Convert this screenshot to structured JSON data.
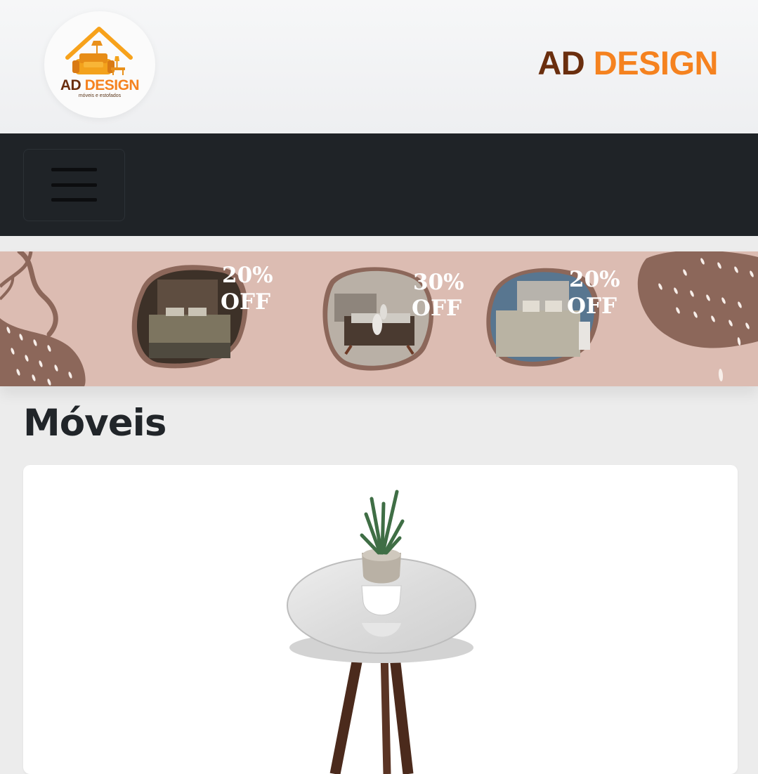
{
  "header": {
    "logo": {
      "word_dark": "AD",
      "word_orange": "DESIGN",
      "subtitle": "móveis e estofados"
    },
    "brand": {
      "dark": "AD",
      "orange": "DESIGN"
    }
  },
  "navbar": {
    "menu_icon": "hamburger-menu-icon"
  },
  "promo_banner": {
    "offers": [
      {
        "percent": "20%",
        "label": "OFF",
        "scene": "bedroom"
      },
      {
        "percent": "30%",
        "label": "OFF",
        "scene": "living-room"
      },
      {
        "percent": "20%",
        "label": "OFF",
        "scene": "bedroom"
      }
    ]
  },
  "section": {
    "title": "Móveis"
  },
  "product": {
    "image": "round side table with plant"
  },
  "colors": {
    "brand_dark": "#6a2e0e",
    "brand_orange": "#f5821f",
    "navbar": "#1f2327",
    "banner": "#dcbcb2",
    "banner_accent": "#8c675a"
  }
}
